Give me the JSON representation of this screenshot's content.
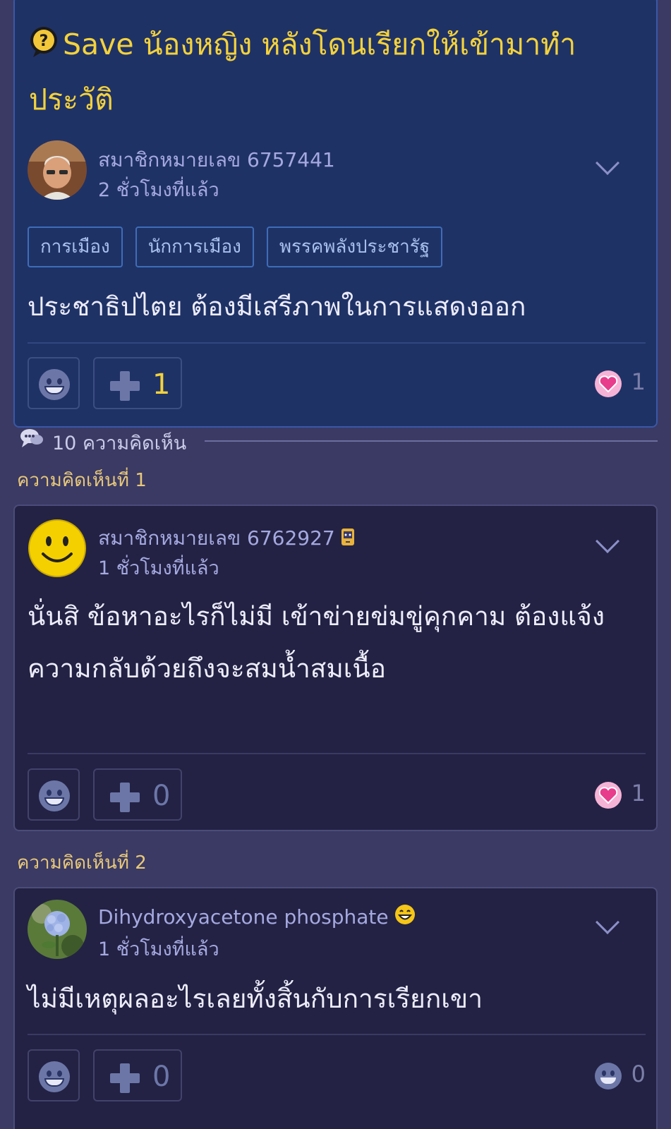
{
  "topic": {
    "title": "Save น้องหญิง หลังโดนเรียกให้เข้ามาทำประวัติ",
    "author": {
      "name": "สมาชิกหมายเลข 6757441",
      "time": "2 ชั่วโมงที่แล้ว"
    },
    "tags": [
      "การเมือง",
      "นักการเมือง",
      "พรรคพลังประชารัฐ"
    ],
    "body": "ประชาธิปไตย ต้องมีเสรีภาพในการแสดงออก",
    "plus_count": "1",
    "reaction_count": "1"
  },
  "comments_section": {
    "count_label": "10 ความคิดเห็น"
  },
  "comments": [
    {
      "number_label": "ความคิดเห็นที่ 1",
      "author": "สมาชิกหมายเลข 6762927",
      "time": "1 ชั่วโมงที่แล้ว",
      "body": "นั่นสิ ข้อหาอะไรก็ไม่มี เข้าข่ายข่มขู่คุกคาม  ต้องแจ้งความกลับด้วยถึงจะสมน้ำสมเนื้อ",
      "plus_count": "0",
      "reaction_count": "1",
      "reaction": "heart"
    },
    {
      "number_label": "ความคิดเห็นที่ 2",
      "author": "Dihydroxyacetone phosphate",
      "time": "1 ชั่วโมงที่แล้ว",
      "body": "ไม่มีเหตุผลอะไรเลยทั้งสิ้นกับการเรียกเขา",
      "plus_count": "0",
      "reaction_count": "0",
      "reaction": "neutral"
    }
  ],
  "icons": {
    "question": "question-bubble-icon",
    "comments": "speech-bubbles-icon",
    "emoji": "grin-emoji-icon",
    "plus": "plus-icon",
    "heart": "heart-reaction-icon",
    "chevron": "chevron-down-icon",
    "mobile_badge": "mobile-device-icon"
  },
  "colors": {
    "background": "#3b3a64",
    "topic_card": "#1f3266",
    "comment_card": "#232244",
    "title": "#f3d23c",
    "comment_label": "#e8c87a",
    "heart": "#f6b3d6"
  }
}
